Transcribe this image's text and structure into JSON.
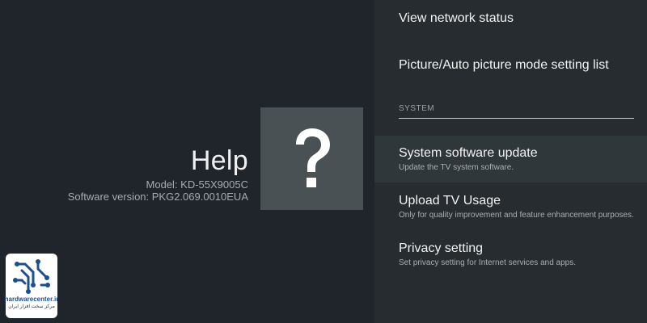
{
  "help_panel": {
    "title": "Help",
    "model_line": "Model: KD-55X9005C",
    "software_line": "Software version: PKG2.069.0010EUA",
    "icon": "question-mark-icon"
  },
  "menu": {
    "items_top": [
      {
        "label": "View network status"
      },
      {
        "label": "Picture/Auto picture mode setting list"
      }
    ],
    "section_header": "SYSTEM",
    "system_items": [
      {
        "label": "System software update",
        "description": "Update the TV system software.",
        "focused": true
      },
      {
        "label": "Upload TV Usage",
        "description": "Only for quality improvement and feature enhancement purposes."
      },
      {
        "label": "Privacy setting",
        "description": "Set privacy setting for Internet services and apps."
      }
    ]
  },
  "watermark": {
    "brand": "hardwarecenter.ir",
    "tagline": "مرکز سخت افزار ایران",
    "color": "#1d4f8f"
  },
  "colors": {
    "background": "#1f252a",
    "menu_background": "#262c30",
    "focused_item": "#30373b",
    "icon_tile": "#4a5154"
  }
}
